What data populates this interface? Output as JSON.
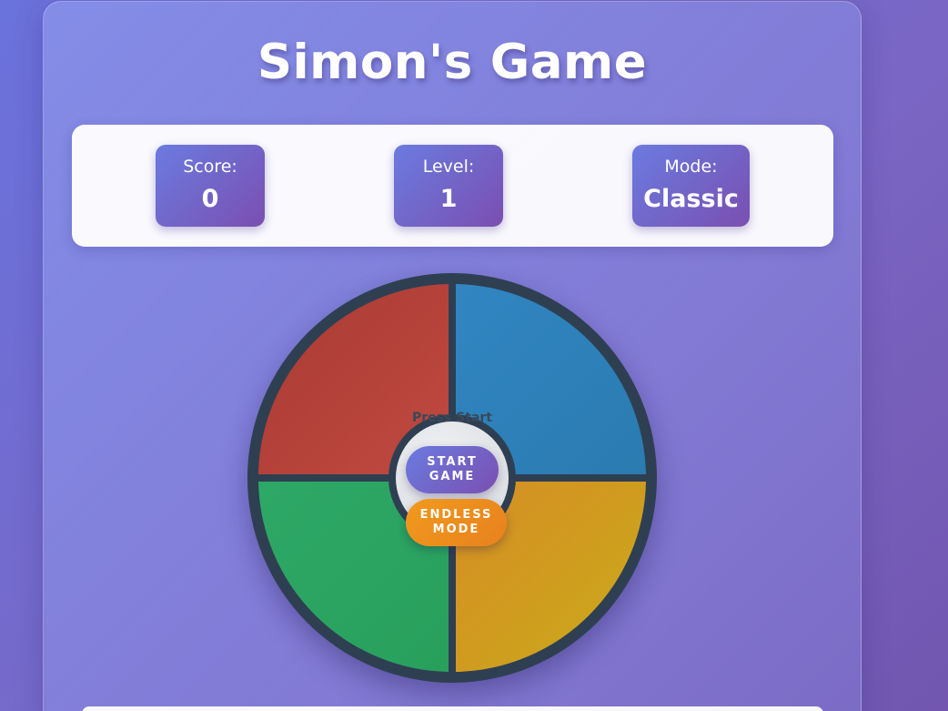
{
  "app": {
    "title": "Simon's Game"
  },
  "stats": {
    "score_label": "Score:",
    "score_value": "0",
    "level_label": "Level:",
    "level_value": "1",
    "mode_label": "Mode:",
    "mode_value": "Classic"
  },
  "board": {
    "status_text": "Press Start",
    "pads": [
      {
        "name": "red",
        "color": "#b5403a"
      },
      {
        "name": "blue",
        "color": "#2e80b9"
      },
      {
        "name": "green",
        "color": "#2ba462"
      },
      {
        "name": "yellow",
        "color": "#cfa01f"
      }
    ],
    "start_button_label": "START\nGAME",
    "endless_button_label": "ENDLESS\nMODE"
  },
  "colors": {
    "accent_gradient_start": "#6b7be0",
    "accent_gradient_end": "#7a4fb0",
    "endless_orange": "#f19a1c",
    "board_frame": "#2f3f52"
  }
}
